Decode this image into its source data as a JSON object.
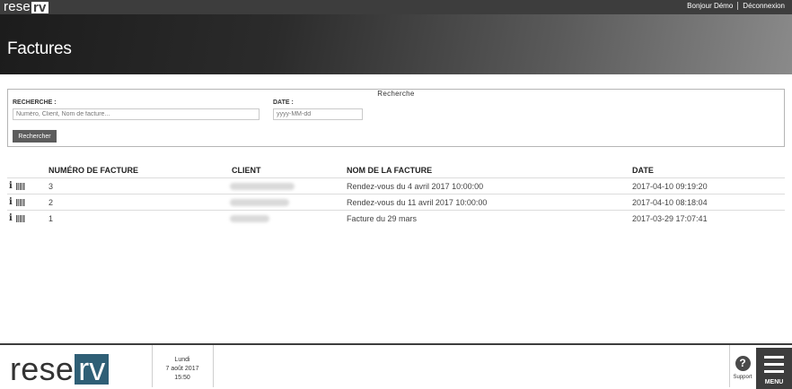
{
  "topbar": {
    "logo_left": "rese",
    "logo_right": "rv",
    "greeting": "Bonjour Démo",
    "logout": "Déconnexion"
  },
  "header": {
    "title": "Factures"
  },
  "search": {
    "legend": "Recherche",
    "query_label": "RECHERCHE :",
    "query_placeholder": "Numéro, Client, Nom de facture...",
    "query_value": "",
    "date_label": "DATE :",
    "date_placeholder": "yyyy-MM-dd",
    "date_value": "",
    "button_label": "Rechercher"
  },
  "table": {
    "columns": [
      "NUMÉRO DE FACTURE",
      "CLIENT",
      "NOM DE LA FACTURE",
      "DATE"
    ],
    "rows": [
      {
        "number": "3",
        "client": "",
        "name": "Rendez-vous du 4 avril 2017 10:00:00",
        "date": "2017-04-10 09:19:20"
      },
      {
        "number": "2",
        "client": "",
        "name": "Rendez-vous du 11 avril 2017 10:00:00",
        "date": "2017-04-10 08:18:04"
      },
      {
        "number": "1",
        "client": "",
        "name": "Facture du 29 mars",
        "date": "2017-03-29 17:07:41"
      }
    ]
  },
  "footer": {
    "logo_left": "rese",
    "logo_right": "rv",
    "day": "Lundi",
    "date": "7 août 2017",
    "time": "15:50",
    "support_label": "Support",
    "menu_label": "MENU"
  },
  "colors": {
    "topbar": "#3d3d3d",
    "brand_blue": "#2f5f76",
    "button": "#5c5c5c"
  },
  "icons": [
    "info-icon",
    "barcode-icon",
    "help-icon",
    "hamburger-menu-icon"
  ]
}
